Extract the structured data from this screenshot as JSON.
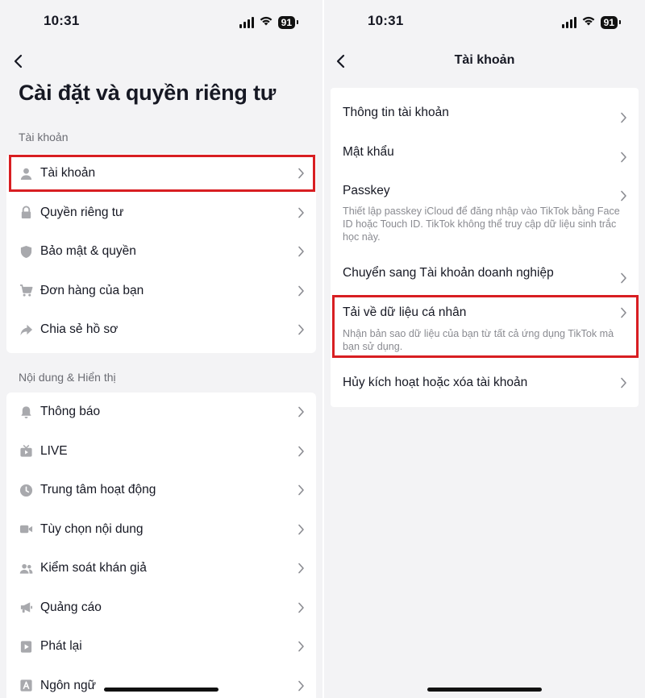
{
  "left": {
    "status": {
      "time": "10:31",
      "battery": "91"
    },
    "title": "Cài đặt và quyền riêng tư",
    "sections": [
      {
        "label": "Tài khoản",
        "items": [
          {
            "label": "Tài khoản",
            "icon": "person-icon"
          },
          {
            "label": "Quyền riêng tư",
            "icon": "lock-icon"
          },
          {
            "label": "Bảo mật & quyền",
            "icon": "shield-icon"
          },
          {
            "label": "Đơn hàng của bạn",
            "icon": "cart-icon"
          },
          {
            "label": "Chia sẻ hồ sơ",
            "icon": "share-icon"
          }
        ]
      },
      {
        "label": "Nội dung & Hiển thị",
        "items": [
          {
            "label": "Thông báo",
            "icon": "bell-icon"
          },
          {
            "label": "LIVE",
            "icon": "tv-icon"
          },
          {
            "label": "Trung tâm hoạt động",
            "icon": "clock-icon"
          },
          {
            "label": "Tùy chọn nội dung",
            "icon": "video-icon"
          },
          {
            "label": "Kiểm soát khán giả",
            "icon": "people-icon"
          },
          {
            "label": "Quảng cáo",
            "icon": "megaphone-icon"
          },
          {
            "label": "Phát lại",
            "icon": "playback-icon"
          },
          {
            "label": "Ngôn ngữ",
            "icon": "language-icon"
          }
        ]
      }
    ]
  },
  "right": {
    "status": {
      "time": "10:31",
      "battery": "91"
    },
    "title": "Tài khoản",
    "items": [
      {
        "label": "Thông tin tài khoản",
        "desc": ""
      },
      {
        "label": "Mật khẩu",
        "desc": ""
      },
      {
        "label": "Passkey",
        "desc": "Thiết lập passkey iCloud để đăng nhập vào TikTok bằng Face ID hoặc Touch ID. TikTok không thể truy cập dữ liệu sinh trắc học này."
      },
      {
        "label": "Chuyển sang Tài khoản doanh nghiệp",
        "desc": ""
      },
      {
        "label": "Tải về dữ liệu cá nhân",
        "desc": "Nhận bản sao dữ liệu của bạn từ tất cả ứng dụng TikTok mà bạn sử dụng."
      },
      {
        "label": "Hủy kích hoạt hoặc xóa tài khoản",
        "desc": ""
      }
    ]
  },
  "colors": {
    "highlight": "#d81e22",
    "background": "#f3f3f5",
    "card": "#ffffff",
    "text": "#161823",
    "secondary": "#8a8b91"
  }
}
